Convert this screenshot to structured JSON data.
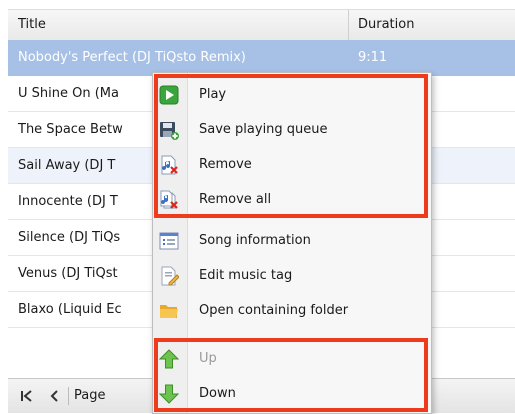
{
  "playlist": {
    "columns": {
      "title": "Title",
      "duration": "Duration"
    },
    "rows": [
      {
        "title": "Nobody's Perfect (DJ TiQsto Remix)",
        "duration": "9:11"
      },
      {
        "title": "U Shine On (Ma"
      },
      {
        "title": "The Space Betw"
      },
      {
        "title": "Sail Away (DJ T"
      },
      {
        "title": "Innocente (DJ T"
      },
      {
        "title": "Silence (DJ TiQs"
      },
      {
        "title": "Venus (DJ TiQst"
      },
      {
        "title": "Blaxo (Liquid Ec"
      }
    ]
  },
  "pager": {
    "first_icon": "first-page-icon",
    "prev_icon": "previous-page-icon",
    "label": "Page"
  },
  "context_menu": {
    "items": [
      {
        "label": "Play",
        "icon": "play-icon"
      },
      {
        "label": "Save playing queue",
        "icon": "save-icon"
      },
      {
        "label": "Remove",
        "icon": "remove-icon"
      },
      {
        "label": "Remove all",
        "icon": "remove-all-icon"
      },
      {
        "label": "Song information",
        "icon": "info-list-icon"
      },
      {
        "label": "Edit music tag",
        "icon": "edit-tag-icon"
      },
      {
        "label": "Open containing folder",
        "icon": "folder-icon"
      },
      {
        "label": "Up",
        "icon": "up-arrow-icon",
        "disabled": true
      },
      {
        "label": "Down",
        "icon": "down-arrow-icon"
      }
    ]
  },
  "colors": {
    "selection": "#a7c0e6",
    "highlight_box": "#ee3b1b",
    "accent_green": "#3aa53a"
  }
}
